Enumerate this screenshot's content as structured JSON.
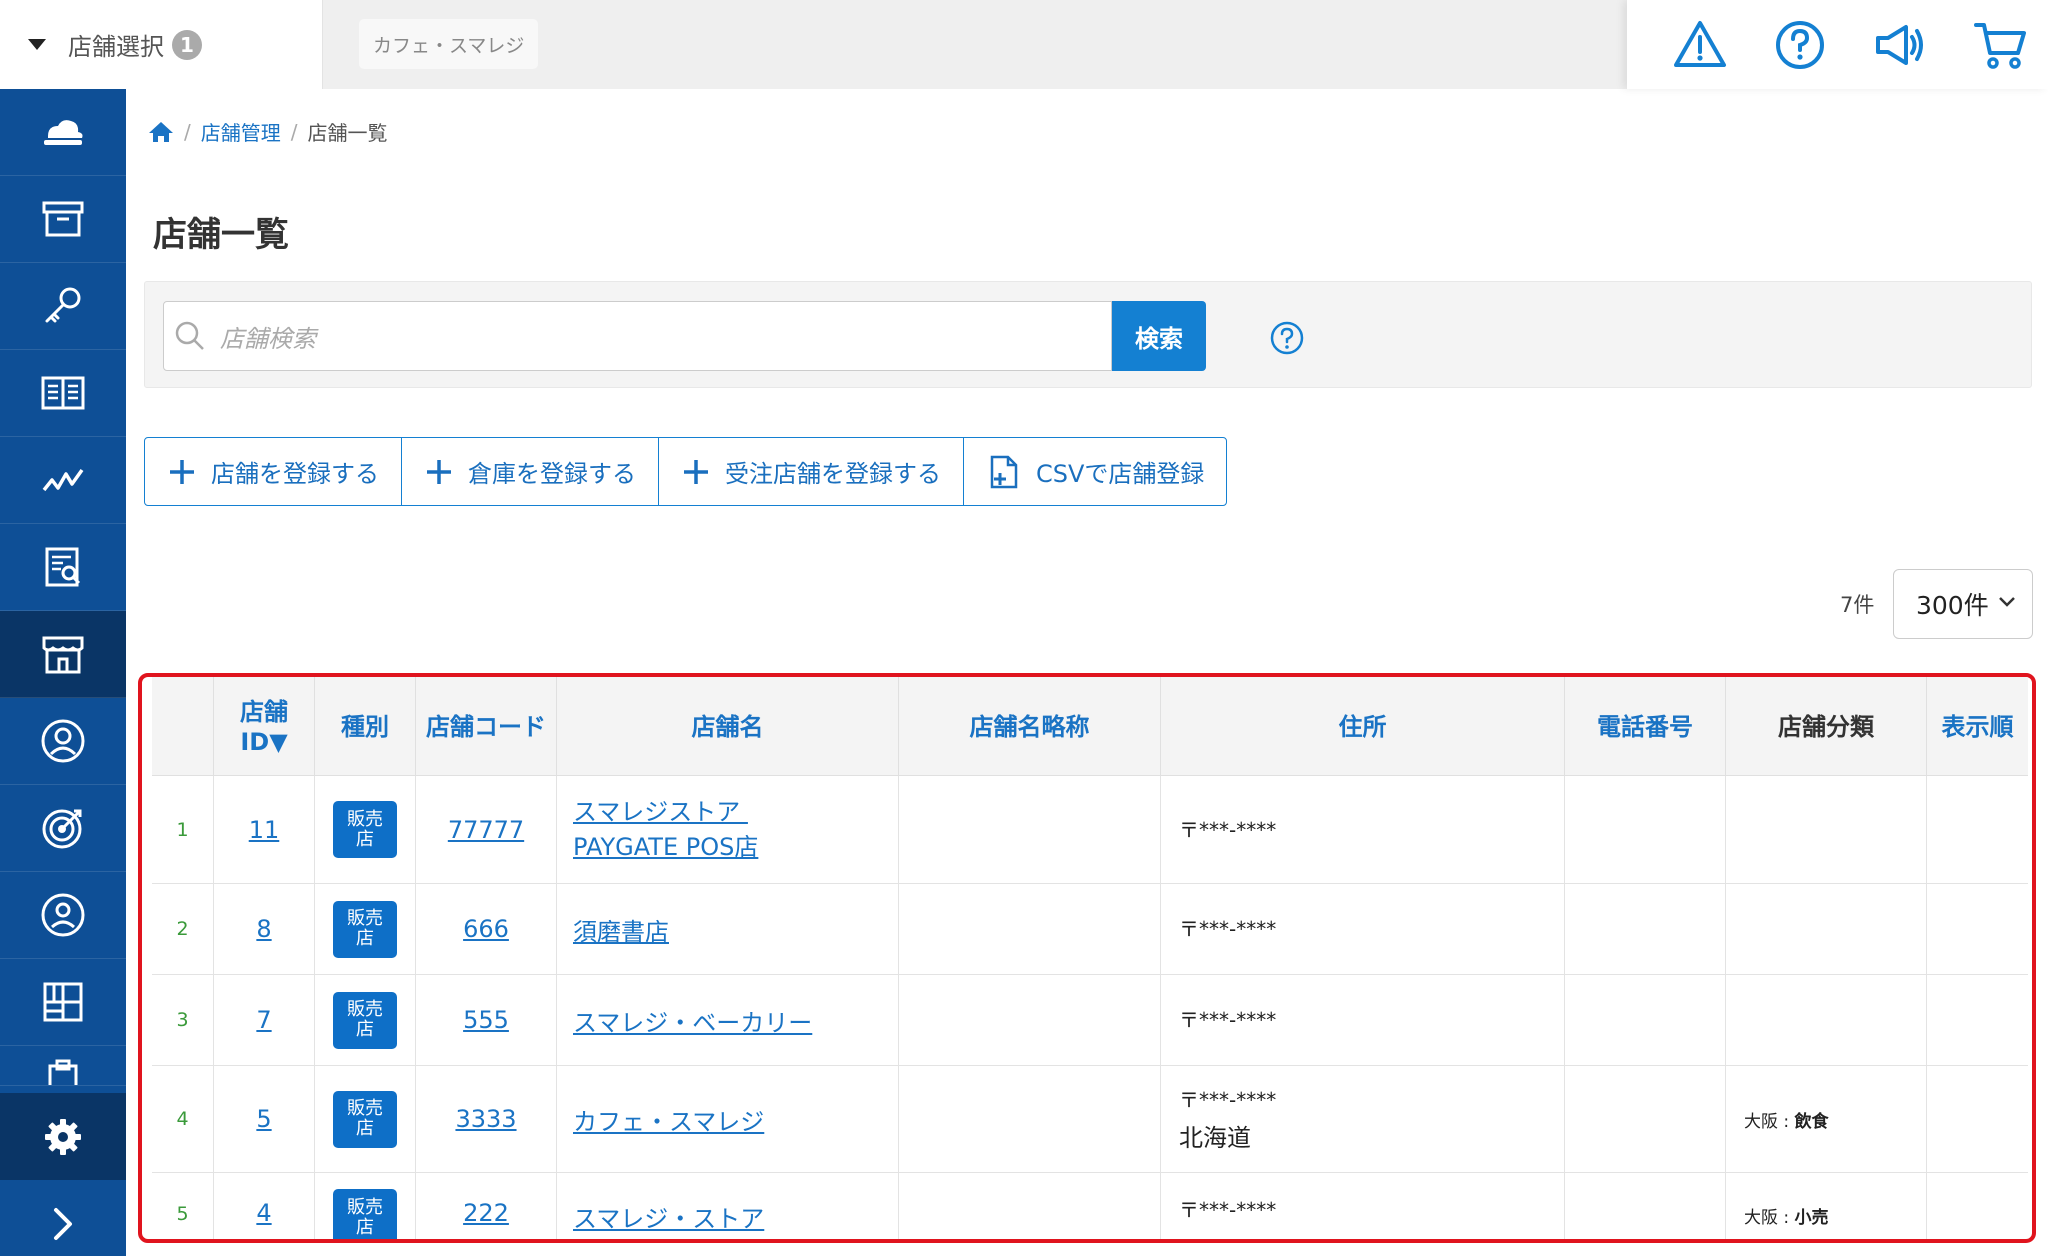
{
  "topbar": {
    "store_select_label": "店舗選択",
    "store_select_count": "1",
    "current_store": "カフェ・スマレジ"
  },
  "breadcrumb": {
    "level1": "店舗管理",
    "current": "店舗一覧"
  },
  "page_title": "店舗一覧",
  "search": {
    "placeholder": "店舗検索",
    "button": "検索"
  },
  "actions": {
    "add_store": "店舗を登録する",
    "add_warehouse": "倉庫を登録する",
    "add_order_store": "受注店舗を登録する",
    "csv_register": "CSVで店舗登録"
  },
  "list": {
    "count": "7件",
    "per_page": "300件"
  },
  "table": {
    "headers": {
      "id_line1": "店舗",
      "id_line2": "ID▼",
      "type": "種別",
      "code": "店舗コード",
      "name": "店舗名",
      "short_name": "店舗名略称",
      "address": "住所",
      "phone": "電話番号",
      "category": "店舗分類",
      "order": "表示順"
    },
    "badge_line1": "販売",
    "badge_line2": "店",
    "rows": [
      {
        "num": "1",
        "id": "11",
        "code": "77777",
        "name_line1": "スマレジストア ",
        "name_line2": "PAYGATE POS店",
        "zip": "〒***-****",
        "pref": "",
        "cat_prefix": "",
        "cat_value": ""
      },
      {
        "num": "2",
        "id": "8",
        "code": "666",
        "name_line1": "須磨書店",
        "name_line2": "",
        "zip": "〒***-****",
        "pref": "",
        "cat_prefix": "",
        "cat_value": ""
      },
      {
        "num": "3",
        "id": "7",
        "code": "555",
        "name_line1": "スマレジ・ベーカリー",
        "name_line2": "",
        "zip": "〒***-****",
        "pref": "",
        "cat_prefix": "",
        "cat_value": ""
      },
      {
        "num": "4",
        "id": "5",
        "code": "3333",
        "name_line1": "カフェ・スマレジ",
        "name_line2": "",
        "zip": "〒***-****",
        "pref": "北海道",
        "cat_prefix": "大阪 : ",
        "cat_value": "飲食"
      },
      {
        "num": "5",
        "id": "4",
        "code": "222",
        "name_line1": "スマレジ・ストア",
        "name_line2": "",
        "zip": "〒***-****",
        "pref": "",
        "cat_prefix": "大阪 : ",
        "cat_value": "小売"
      }
    ]
  },
  "colors": {
    "sidebar": "#0e4f96",
    "sidebar_active": "#0a3566",
    "accent": "#1480d2",
    "highlight_border": "#e0141e"
  }
}
